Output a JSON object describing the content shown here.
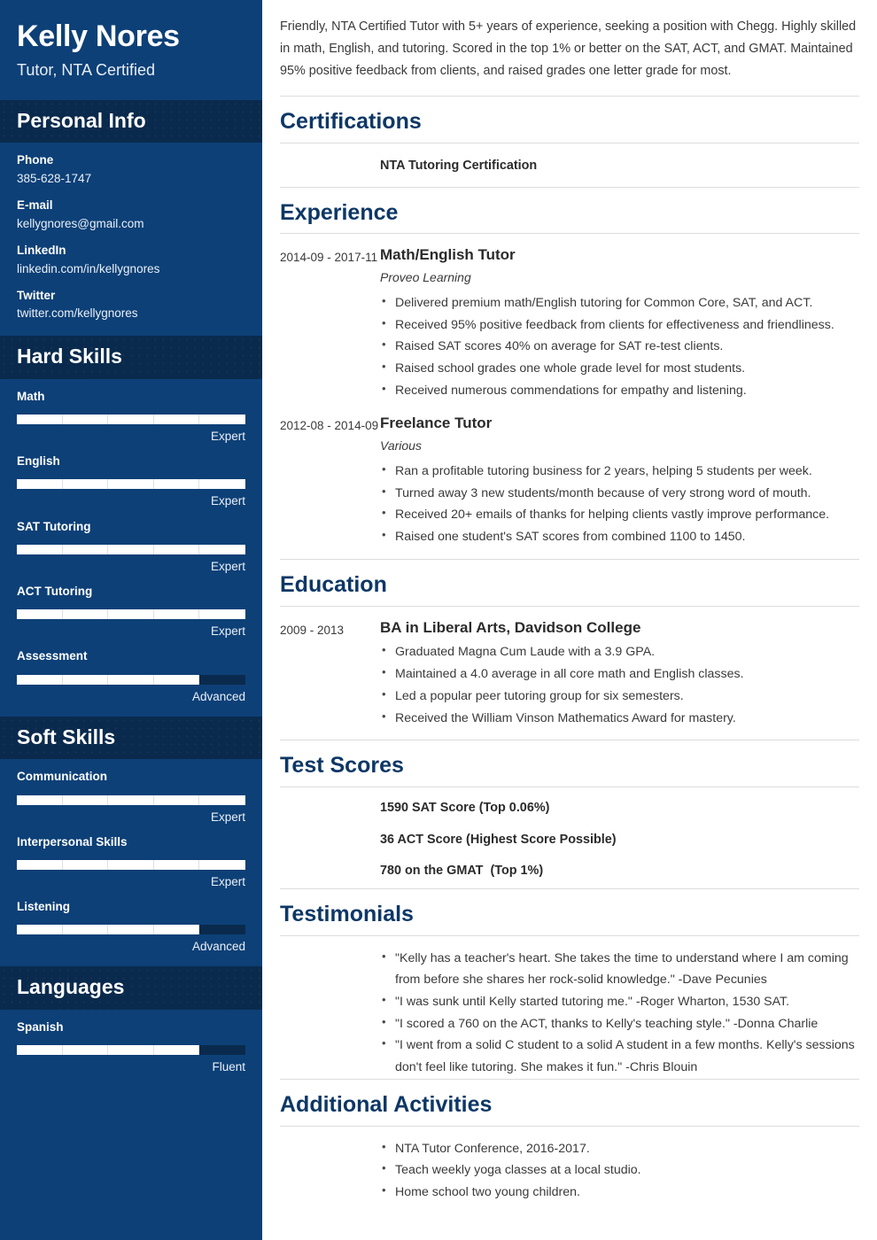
{
  "colors": {
    "sidebar_bg": "#0d4077",
    "sidebar_band_bg": "#0a2a4d",
    "heading_navy": "#0d3766",
    "bar_fill": "#ffffff",
    "bar_track": "#0a2a4d",
    "body_text": "#3a3a3a",
    "rule": "#dddddd"
  },
  "sidebar": {
    "name": "Kelly Nores",
    "job_title": "Tutor, NTA Certified",
    "personal_info": {
      "heading": "Personal Info",
      "items": [
        {
          "label": "Phone",
          "value": "385-628-1747"
        },
        {
          "label": "E-mail",
          "value": "kellygnores@gmail.com"
        },
        {
          "label": "LinkedIn",
          "value": "linkedin.com/in/kellygnores"
        },
        {
          "label": "Twitter",
          "value": "twitter.com/kellygnores"
        }
      ]
    },
    "hard_skills": {
      "heading": "Hard Skills",
      "items": [
        {
          "name": "Math",
          "level": "Expert",
          "percent": 100
        },
        {
          "name": "English",
          "level": "Expert",
          "percent": 100
        },
        {
          "name": "SAT Tutoring",
          "level": "Expert",
          "percent": 100
        },
        {
          "name": "ACT Tutoring",
          "level": "Expert",
          "percent": 100
        },
        {
          "name": "Assessment",
          "level": "Advanced",
          "percent": 80
        }
      ]
    },
    "soft_skills": {
      "heading": "Soft Skills",
      "items": [
        {
          "name": "Communication",
          "level": "Expert",
          "percent": 100
        },
        {
          "name": "Interpersonal Skills",
          "level": "Expert",
          "percent": 100
        },
        {
          "name": "Listening",
          "level": "Advanced",
          "percent": 80
        }
      ]
    },
    "languages": {
      "heading": "Languages",
      "items": [
        {
          "name": "Spanish",
          "level": "Fluent",
          "percent": 80
        }
      ]
    }
  },
  "main": {
    "summary": "Friendly, NTA Certified Tutor with 5+ years of experience, seeking a position with Chegg. Highly skilled in math, English, and tutoring. Scored in the top 1% or better on the SAT, ACT, and GMAT. Maintained 95% positive feedback from clients, and raised grades one letter grade for most.",
    "certifications": {
      "heading": "Certifications",
      "items": [
        "NTA Tutoring Certification"
      ]
    },
    "experience": {
      "heading": "Experience",
      "entries": [
        {
          "dates": "2014-09 -\n2017-11",
          "role": "Math/English Tutor",
          "org": "Proveo Learning",
          "bullets": [
            "Delivered premium math/English tutoring for Common Core, SAT, and ACT.",
            "Received 95% positive feedback from clients for effectiveness and friendliness.",
            "Raised SAT scores 40% on average for SAT re-test clients.",
            "Raised school grades one whole grade level for most students.",
            "Received numerous commendations for empathy and listening."
          ]
        },
        {
          "dates": "2012-08 -\n2014-09",
          "role": "Freelance Tutor",
          "org": "Various",
          "bullets": [
            "Ran a profitable tutoring business for 2 years, helping 5 students per week.",
            "Turned away 3 new students/month because of very strong word of mouth.",
            "Received 20+ emails of thanks for helping clients vastly improve performance.",
            "Raised one student's SAT scores from combined 1100 to 1450."
          ]
        }
      ]
    },
    "education": {
      "heading": "Education",
      "entries": [
        {
          "dates": "2009 -\n2013",
          "role": "BA in Liberal Arts, Davidson College",
          "org": "",
          "bullets": [
            "Graduated Magna Cum Laude with a 3.9 GPA.",
            "Maintained a 4.0 average in all core math and English classes.",
            "Led a popular peer tutoring group for six semesters.",
            "Received the William Vinson Mathematics Award for mastery."
          ]
        }
      ]
    },
    "test_scores": {
      "heading": "Test Scores",
      "items": [
        "1590 SAT Score (Top 0.06%)",
        "36 ACT Score (Highest Score Possible)",
        "780 on the GMAT  (Top 1%)"
      ]
    },
    "testimonials": {
      "heading": "Testimonials",
      "items": [
        "\"Kelly has a teacher's heart. She takes the time to understand where I am coming from before she shares her rock-solid knowledge.\" -Dave Pecunies",
        "\"I was sunk until Kelly started tutoring me.\" -Roger Wharton, 1530 SAT.",
        "\"I scored a 760 on the ACT, thanks to Kelly's teaching style.\" -Donna Charlie",
        "\"I went from a solid C student to a solid A student in a few months. Kelly's sessions don't feel like tutoring. She makes it fun.\" -Chris Blouin"
      ]
    },
    "additional_activities": {
      "heading": "Additional Activities",
      "items": [
        "NTA Tutor Conference, 2016-2017.",
        "Teach weekly yoga classes at a local studio.",
        "Home school two young children."
      ]
    }
  }
}
